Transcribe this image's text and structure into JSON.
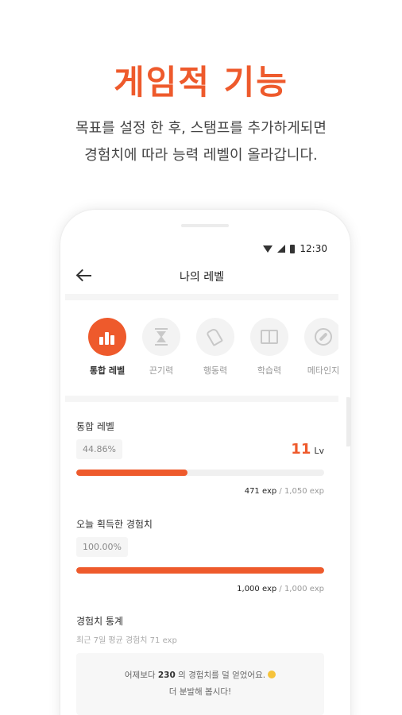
{
  "promo": {
    "headline": "게임적 기능",
    "subtitle_line1": "목표를 설정 한 후, 스탬프를 추가하게되면",
    "subtitle_line2": "경험치에 따라 능력 레벨이 올라갑니다."
  },
  "status_bar": {
    "time": "12:30"
  },
  "app_bar": {
    "title": "나의 레벨",
    "back_icon": "arrow-left-icon"
  },
  "categories": [
    {
      "label": "통합 레벨",
      "icon": "bar-chart-icon",
      "selected": true
    },
    {
      "label": "끈기력",
      "icon": "hourglass-icon",
      "selected": false
    },
    {
      "label": "행동력",
      "icon": "shoe-icon",
      "selected": false
    },
    {
      "label": "학습력",
      "icon": "book-icon",
      "selected": false
    },
    {
      "label": "메타인지",
      "icon": "compass-icon",
      "selected": false
    }
  ],
  "total_level": {
    "title": "통합 레벨",
    "percent_text": "44.86%",
    "percent": 44.86,
    "level_number": "11",
    "level_unit": "Lv",
    "exp_current": "471 exp",
    "exp_total": " / 1,050 exp"
  },
  "today_exp": {
    "title": "오늘 획득한 경험치",
    "percent_text": "100.00%",
    "percent": 100,
    "exp_current": "1,000 exp",
    "exp_total": " / 1,000 exp"
  },
  "stats": {
    "title": "경험치 통계",
    "subtitle": "최근 7일 평균 경험치 71 exp",
    "message_prefix": "어제보다",
    "message_value": "230",
    "message_suffix": "의 경험치를 덜 얻었어요.",
    "message_line2": "더 분발해 봅시다!"
  },
  "colors": {
    "accent": "#ee5a2c",
    "track": "#f0f0f0",
    "chip": "#f5f5f5"
  }
}
